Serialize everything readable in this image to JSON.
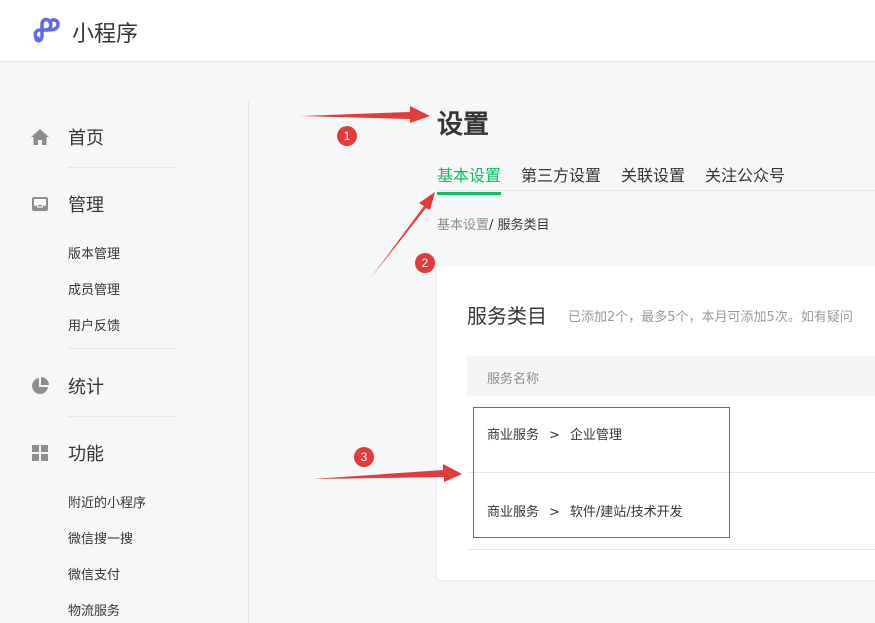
{
  "app": {
    "title": "小程序",
    "logo": "mini-program-logo",
    "accent": "#07c160",
    "annotation_color": "#e33b3b"
  },
  "sidebar": {
    "home": {
      "label": "首页",
      "icon": "home-icon"
    },
    "manage": {
      "label": "管理",
      "icon": "inbox-icon",
      "items": [
        "版本管理",
        "成员管理",
        "用户反馈"
      ]
    },
    "stats": {
      "label": "统计",
      "icon": "pie-chart-icon"
    },
    "features": {
      "label": "功能",
      "icon": "grid-icon",
      "items": [
        "附近的小程序",
        "微信搜一搜",
        "微信支付",
        "物流服务"
      ]
    }
  },
  "main": {
    "title": "设置",
    "tabs": [
      "基本设置",
      "第三方设置",
      "关联设置",
      "关注公众号"
    ],
    "active_tab": "基本设置",
    "breadcrumb": {
      "parent": "基本设置",
      "separator": "/",
      "current": " 服务类目"
    },
    "card": {
      "title": "服务类目",
      "note": "已添加2个，最多5个，本月可添加5次。如有疑问",
      "column_header": "服务名称",
      "rows": [
        {
          "category": "商业服务",
          "arrow": ">",
          "subcategory": "企业管理"
        },
        {
          "category": "商业服务",
          "arrow": ">",
          "subcategory": "软件/建站/技术开发"
        }
      ]
    }
  },
  "annotations": {
    "markers": [
      "1",
      "2",
      "3"
    ]
  }
}
